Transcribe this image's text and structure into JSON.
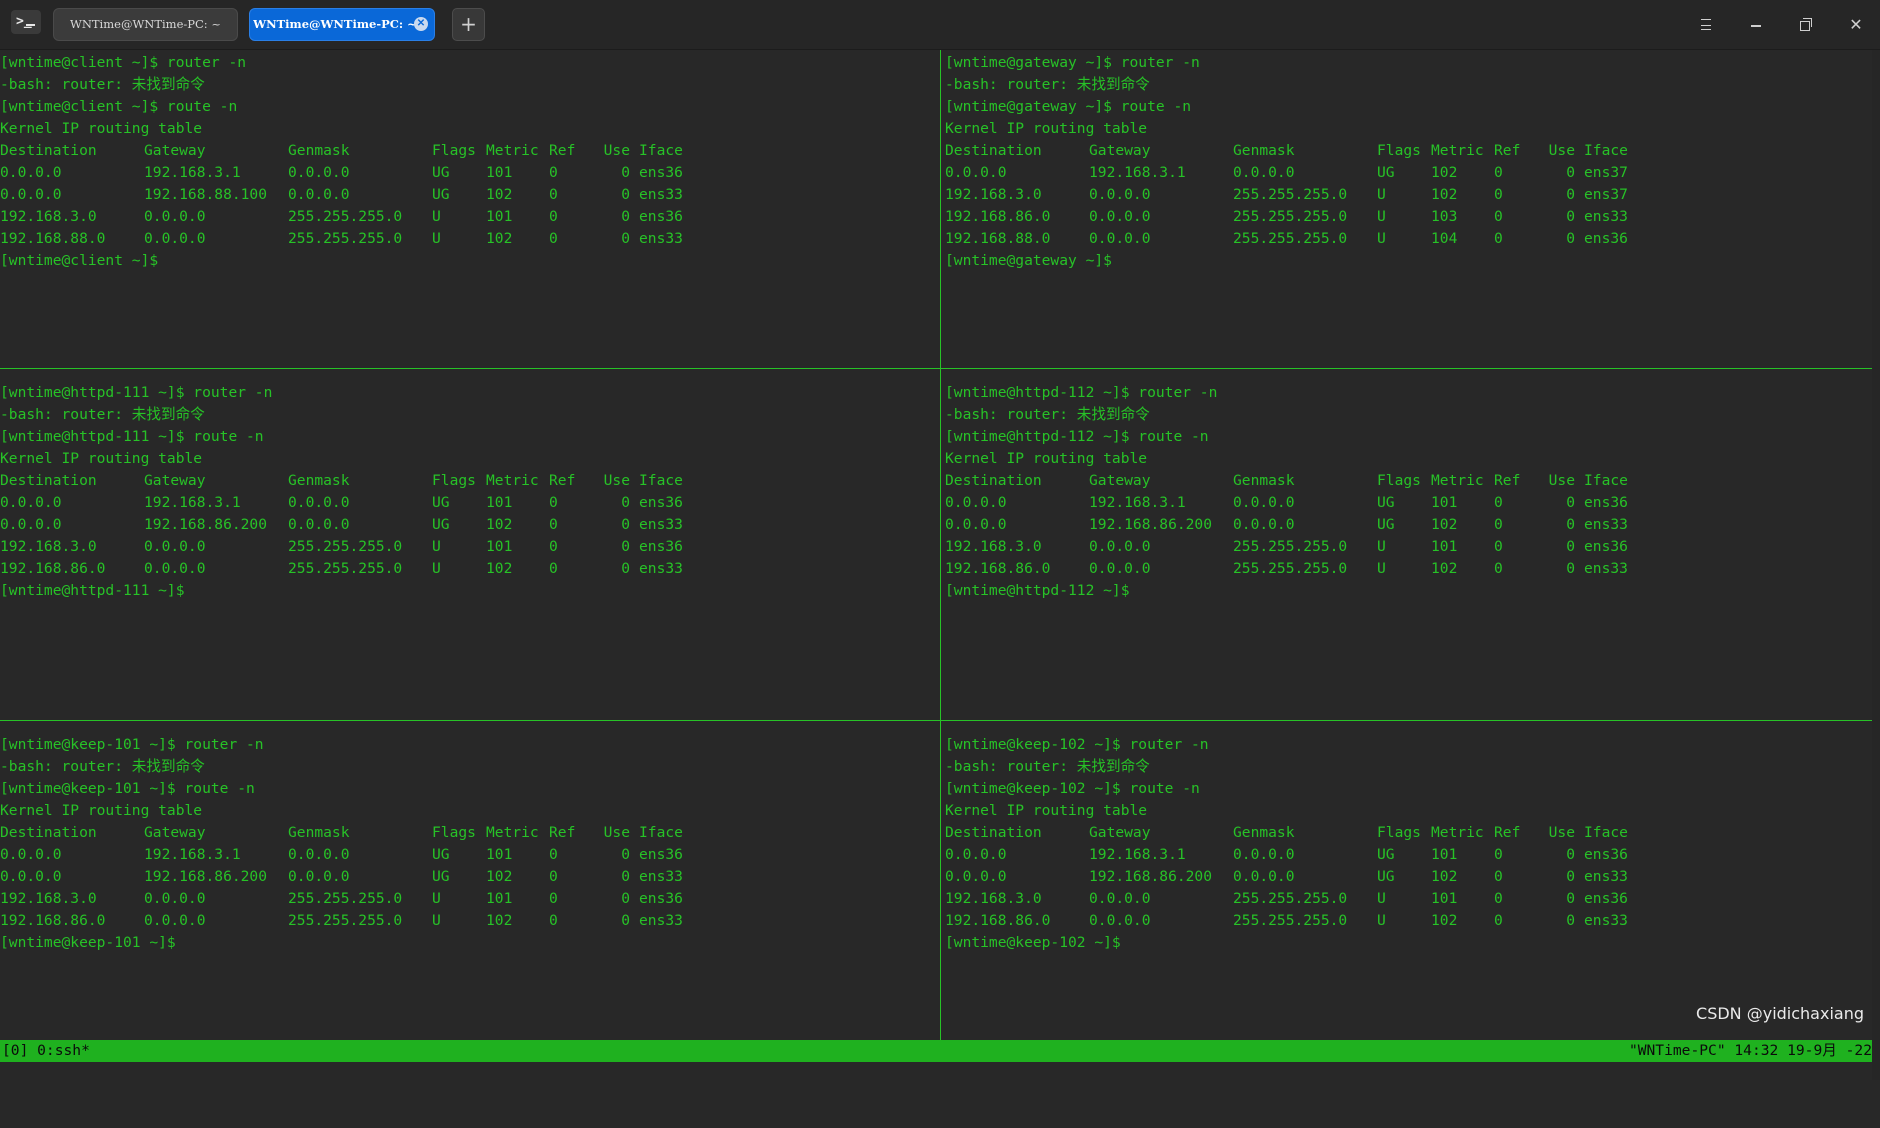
{
  "window": {
    "tabs": [
      {
        "label": "WNTime@WNTime-PC: ~",
        "active": false
      },
      {
        "label": "WNTime@WNTime-PC: ~",
        "active": true
      }
    ],
    "app_icon_text": ">_",
    "add_tab_label": "+",
    "menu_icon": "hamburger-icon",
    "minimize_icon": "minimize-icon",
    "maximize_icon": "restore-icon",
    "close_icon": "close-icon",
    "close_label": "✕"
  },
  "accent_color": "#27c227",
  "status_bar_color": "#1fb11f",
  "tab_active_color": "#0a68d8",
  "panes": [
    {
      "lines": [
        "[wntime@client ~]$ router -n",
        "-bash: router: 未找到命令",
        "[wntime@client ~]$ route -n",
        "Kernel IP routing table"
      ],
      "header": [
        "Destination",
        "Gateway",
        "Genmask",
        "Flags",
        "Metric",
        "Ref",
        "Use",
        "Iface"
      ],
      "rows": [
        [
          "0.0.0.0",
          "192.168.3.1",
          "0.0.0.0",
          "UG",
          "101",
          "0",
          "0",
          "ens36"
        ],
        [
          "0.0.0.0",
          "192.168.88.100",
          "0.0.0.0",
          "UG",
          "102",
          "0",
          "0",
          "ens33"
        ],
        [
          "192.168.3.0",
          "0.0.0.0",
          "255.255.255.0",
          "U",
          "101",
          "0",
          "0",
          "ens36"
        ],
        [
          "192.168.88.0",
          "0.0.0.0",
          "255.255.255.0",
          "U",
          "102",
          "0",
          "0",
          "ens33"
        ]
      ],
      "prompt": "[wntime@client ~]$"
    },
    {
      "lines": [
        "[wntime@gateway ~]$ router -n",
        "-bash: router: 未找到命令",
        "[wntime@gateway ~]$ route -n",
        "Kernel IP routing table"
      ],
      "header": [
        "Destination",
        "Gateway",
        "Genmask",
        "Flags",
        "Metric",
        "Ref",
        "Use",
        "Iface"
      ],
      "rows": [
        [
          "0.0.0.0",
          "192.168.3.1",
          "0.0.0.0",
          "UG",
          "102",
          "0",
          "0",
          "ens37"
        ],
        [
          "192.168.3.0",
          "0.0.0.0",
          "255.255.255.0",
          "U",
          "102",
          "0",
          "0",
          "ens37"
        ],
        [
          "192.168.86.0",
          "0.0.0.0",
          "255.255.255.0",
          "U",
          "103",
          "0",
          "0",
          "ens33"
        ],
        [
          "192.168.88.0",
          "0.0.0.0",
          "255.255.255.0",
          "U",
          "104",
          "0",
          "0",
          "ens36"
        ]
      ],
      "prompt": "[wntime@gateway ~]$"
    },
    {
      "lines": [
        "[wntime@httpd-111 ~]$ router -n",
        "-bash: router: 未找到命令",
        "[wntime@httpd-111 ~]$ route -n",
        "Kernel IP routing table"
      ],
      "header": [
        "Destination",
        "Gateway",
        "Genmask",
        "Flags",
        "Metric",
        "Ref",
        "Use",
        "Iface"
      ],
      "rows": [
        [
          "0.0.0.0",
          "192.168.3.1",
          "0.0.0.0",
          "UG",
          "101",
          "0",
          "0",
          "ens36"
        ],
        [
          "0.0.0.0",
          "192.168.86.200",
          "0.0.0.0",
          "UG",
          "102",
          "0",
          "0",
          "ens33"
        ],
        [
          "192.168.3.0",
          "0.0.0.0",
          "255.255.255.0",
          "U",
          "101",
          "0",
          "0",
          "ens36"
        ],
        [
          "192.168.86.0",
          "0.0.0.0",
          "255.255.255.0",
          "U",
          "102",
          "0",
          "0",
          "ens33"
        ]
      ],
      "prompt": "[wntime@httpd-111 ~]$"
    },
    {
      "lines": [
        "[wntime@httpd-112 ~]$ router -n",
        "-bash: router: 未找到命令",
        "[wntime@httpd-112 ~]$ route -n",
        "Kernel IP routing table"
      ],
      "header": [
        "Destination",
        "Gateway",
        "Genmask",
        "Flags",
        "Metric",
        "Ref",
        "Use",
        "Iface"
      ],
      "rows": [
        [
          "0.0.0.0",
          "192.168.3.1",
          "0.0.0.0",
          "UG",
          "101",
          "0",
          "0",
          "ens36"
        ],
        [
          "0.0.0.0",
          "192.168.86.200",
          "0.0.0.0",
          "UG",
          "102",
          "0",
          "0",
          "ens33"
        ],
        [
          "192.168.3.0",
          "0.0.0.0",
          "255.255.255.0",
          "U",
          "101",
          "0",
          "0",
          "ens36"
        ],
        [
          "192.168.86.0",
          "0.0.0.0",
          "255.255.255.0",
          "U",
          "102",
          "0",
          "0",
          "ens33"
        ]
      ],
      "prompt": "[wntime@httpd-112 ~]$"
    },
    {
      "lines": [
        "[wntime@keep-101 ~]$ router -n",
        "-bash: router: 未找到命令",
        "[wntime@keep-101 ~]$ route -n",
        "Kernel IP routing table"
      ],
      "header": [
        "Destination",
        "Gateway",
        "Genmask",
        "Flags",
        "Metric",
        "Ref",
        "Use",
        "Iface"
      ],
      "rows": [
        [
          "0.0.0.0",
          "192.168.3.1",
          "0.0.0.0",
          "UG",
          "101",
          "0",
          "0",
          "ens36"
        ],
        [
          "0.0.0.0",
          "192.168.86.200",
          "0.0.0.0",
          "UG",
          "102",
          "0",
          "0",
          "ens33"
        ],
        [
          "192.168.3.0",
          "0.0.0.0",
          "255.255.255.0",
          "U",
          "101",
          "0",
          "0",
          "ens36"
        ],
        [
          "192.168.86.0",
          "0.0.0.0",
          "255.255.255.0",
          "U",
          "102",
          "0",
          "0",
          "ens33"
        ]
      ],
      "prompt": "[wntime@keep-101 ~]$"
    },
    {
      "lines": [
        "[wntime@keep-102 ~]$ router -n",
        "-bash: router: 未找到命令",
        "[wntime@keep-102 ~]$ route -n",
        "Kernel IP routing table"
      ],
      "header": [
        "Destination",
        "Gateway",
        "Genmask",
        "Flags",
        "Metric",
        "Ref",
        "Use",
        "Iface"
      ],
      "rows": [
        [
          "0.0.0.0",
          "192.168.3.1",
          "0.0.0.0",
          "UG",
          "101",
          "0",
          "0",
          "ens36"
        ],
        [
          "0.0.0.0",
          "192.168.86.200",
          "0.0.0.0",
          "UG",
          "102",
          "0",
          "0",
          "ens33"
        ],
        [
          "192.168.3.0",
          "0.0.0.0",
          "255.255.255.0",
          "U",
          "101",
          "0",
          "0",
          "ens36"
        ],
        [
          "192.168.86.0",
          "0.0.0.0",
          "255.255.255.0",
          "U",
          "102",
          "0",
          "0",
          "ens33"
        ]
      ],
      "prompt": "[wntime@keep-102 ~]$"
    }
  ],
  "status_bar": {
    "left": "[0] 0:ssh*",
    "right": "\"WNTime-PC\" 14:32 19-9月 -22"
  },
  "watermark": "CSDN @yidichaxiang"
}
